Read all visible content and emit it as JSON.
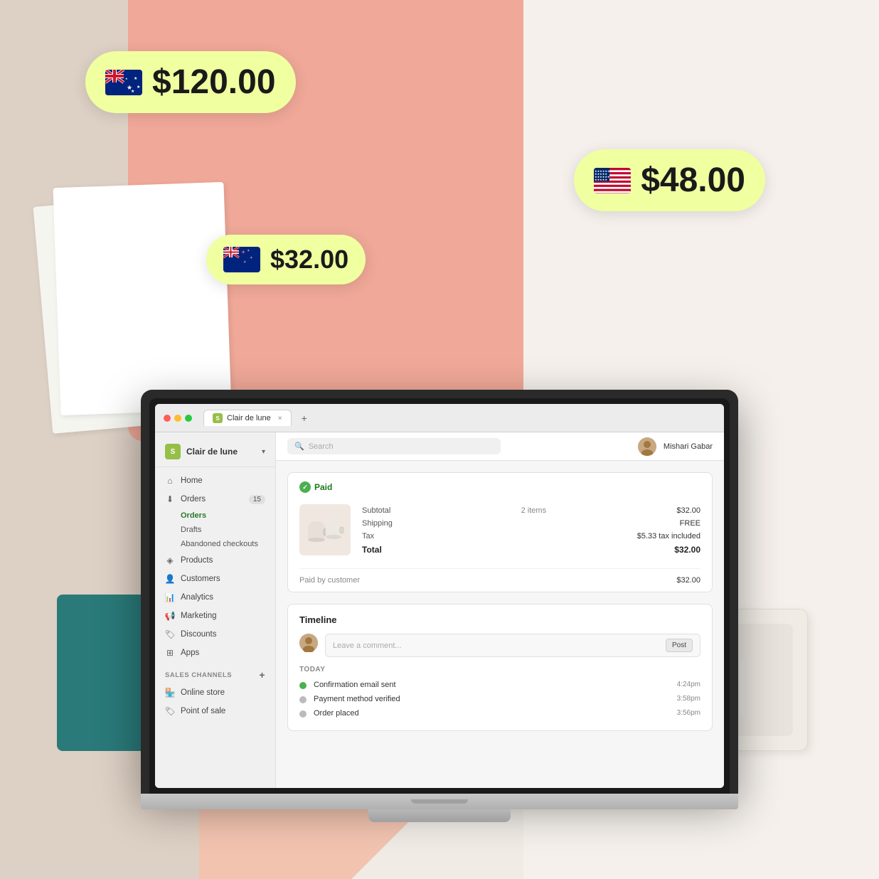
{
  "scene": {
    "bubbles": {
      "australia": {
        "flag": "AU",
        "amount": "$120.00"
      },
      "usa": {
        "flag": "US",
        "amount": "$48.00"
      },
      "newzealand": {
        "flag": "NZ",
        "amount": "$32.00"
      }
    }
  },
  "browser": {
    "tab_name": "Clair de lune",
    "url_text": "Search"
  },
  "sidebar": {
    "store_name": "Clair de lune",
    "items": [
      {
        "label": "Home",
        "icon": "home"
      },
      {
        "label": "Orders",
        "icon": "orders",
        "badge": "15"
      },
      {
        "label": "Orders",
        "icon": null,
        "sub": true,
        "active": true
      },
      {
        "label": "Drafts",
        "icon": null,
        "sub": true
      },
      {
        "label": "Abandoned checkouts",
        "icon": null,
        "sub": true
      },
      {
        "label": "Products",
        "icon": "products"
      },
      {
        "label": "Customers",
        "icon": "customers"
      },
      {
        "label": "Analytics",
        "icon": "analytics"
      },
      {
        "label": "Marketing",
        "icon": "marketing"
      },
      {
        "label": "Discounts",
        "icon": "discounts"
      },
      {
        "label": "Apps",
        "icon": "apps"
      }
    ],
    "sales_channels_label": "SALES CHANNELS",
    "sales_channels": [
      {
        "label": "Online store"
      },
      {
        "label": "Point of sale"
      }
    ]
  },
  "topbar": {
    "search_placeholder": "Search",
    "user_name": "Mishari Gabar"
  },
  "order": {
    "status": "Paid",
    "subtotal_label": "Subtotal",
    "subtotal_items": "2 items",
    "subtotal_value": "$32.00",
    "shipping_label": "Shipping",
    "shipping_value": "FREE",
    "tax_label": "Tax",
    "tax_value": "$5.33 tax included",
    "total_label": "Total",
    "total_value": "$32.00",
    "paid_by_label": "Paid by customer",
    "paid_by_value": "$32.00"
  },
  "timeline": {
    "title": "Timeline",
    "comment_placeholder": "Leave a comment...",
    "post_button": "Post",
    "day_label": "TODAY",
    "events": [
      {
        "text": "Confirmation email sent",
        "time": "4:24pm",
        "type": "green"
      },
      {
        "text": "Payment method verified",
        "time": "3:58pm",
        "type": "gray"
      },
      {
        "text": "Order placed",
        "time": "3:56pm",
        "type": "gray"
      }
    ]
  }
}
